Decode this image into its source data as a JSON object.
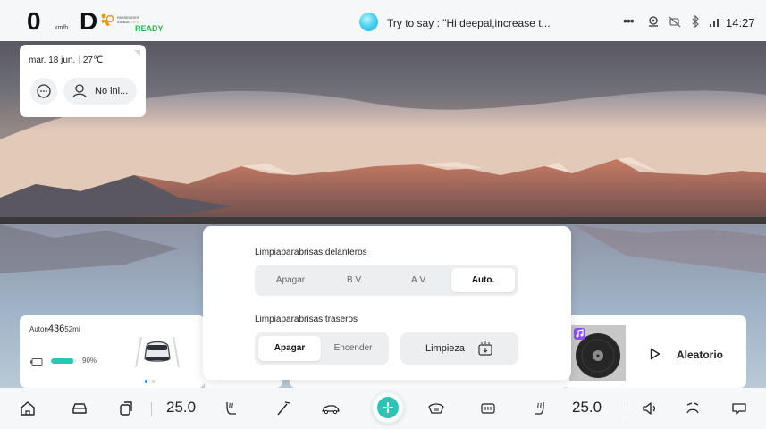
{
  "status_bar": {
    "speed": "0",
    "speed_unit": "km/h",
    "gear": "D",
    "airbag_line1": "PASSENGER",
    "airbag_line2": "AIRBAG",
    "airbag_state": "OFF",
    "ready_label": "READY",
    "voice_prompt": "Try to say : \"Hi deepal,increase t...",
    "more_icon": "more-dots-icon",
    "time": "14:27",
    "icons": [
      "location-pin-icon",
      "camera-off-icon",
      "bluetooth-icon",
      "signal-icon"
    ]
  },
  "date_card": {
    "date": "mar. 18 jun.",
    "temperature": "27℃",
    "chat_icon": "chat-bubble-icon",
    "user_label": "No ini..."
  },
  "range_card": {
    "label_prefix": "Auton",
    "range_value": "436",
    "range_unit": "52mi",
    "battery_percent_label": "90%",
    "battery_level": 0.9,
    "pages": 2,
    "active_page": 1
  },
  "music_card": {
    "play_icon": "play-icon",
    "shuffle_label": "Aleatorio"
  },
  "wiper_panel": {
    "front_label": "Limpiaparabrisas delanteros",
    "front_options": [
      "Apagar",
      "B.V.",
      "A.V.",
      "Auto."
    ],
    "front_selected": "Auto.",
    "rear_label": "Limpiaparabrisas traseros",
    "rear_options": [
      "Apagar",
      "Encender"
    ],
    "rear_selected": "Apagar",
    "clean_label": "Limpieza"
  },
  "dock": {
    "left_temp": "25.0",
    "right_temp": "25.0",
    "icons": [
      "home-icon",
      "car-icon",
      "apps-icon",
      "seat-heat-icon",
      "wiper-icon",
      "car-side-icon",
      "fan-icon",
      "front-defrost-icon",
      "rear-defrost-icon",
      "seat-heat-right-icon",
      "volume-icon",
      "steering-wheel-icon",
      "chat-icon"
    ]
  },
  "colors": {
    "accent": "#25c7b8",
    "ready": "#2db34a",
    "airbag_off": "#e39b12",
    "music_badge": "#8b4dff"
  }
}
